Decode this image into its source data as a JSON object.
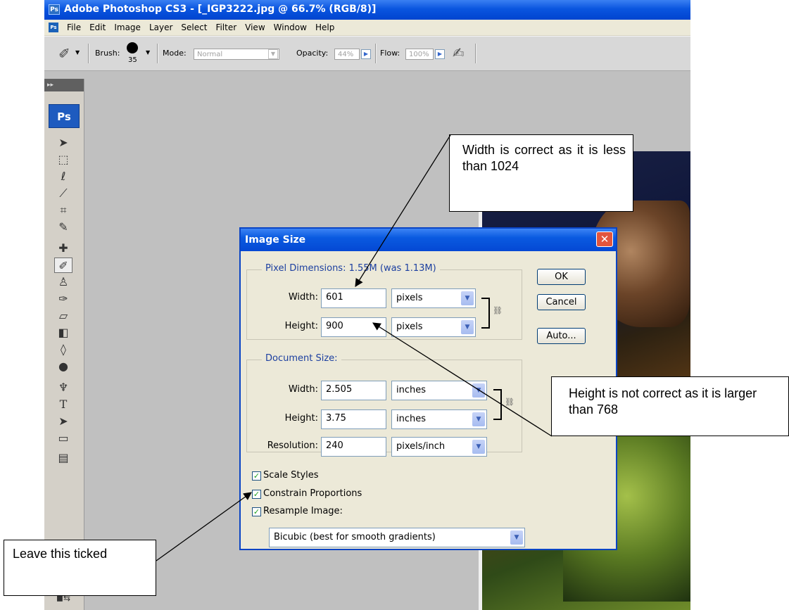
{
  "window": {
    "logo": "Ps",
    "title": "Adobe Photoshop CS3 - [_IGP3222.jpg @ 66.7% (RGB/8)]"
  },
  "menubar": {
    "items": [
      "File",
      "Edit",
      "Image",
      "Layer",
      "Select",
      "Filter",
      "View",
      "Window",
      "Help"
    ]
  },
  "options_bar": {
    "brush_label": "Brush:",
    "brush_size": "35",
    "mode_label": "Mode:",
    "mode_value": "Normal",
    "opacity_label": "Opacity:",
    "opacity_value": "44%",
    "flow_label": "Flow:",
    "flow_value": "100%"
  },
  "toolbox": {
    "badge": "Ps",
    "tools": [
      "move-tool-icon",
      "marquee-tool-icon",
      "lasso-tool-icon",
      "magic-wand-icon",
      "crop-tool-icon",
      "slice-tool-icon",
      "healing-brush-icon",
      "brush-tool-icon",
      "clone-stamp-icon",
      "history-brush-icon",
      "eraser-icon",
      "gradient-tool-icon",
      "blur-tool-icon",
      "dodge-tool-icon",
      "pen-tool-icon",
      "type-tool-icon",
      "path-selection-icon",
      "shape-tool-icon",
      "notes-tool-icon"
    ]
  },
  "dialog": {
    "title": "Image Size",
    "pixel_dimensions": {
      "legend": "Pixel Dimensions:  1.55M (was 1.13M)",
      "width_label": "Width:",
      "width_value": "601",
      "width_unit": "pixels",
      "height_label": "Height:",
      "height_value": "900",
      "height_unit": "pixels"
    },
    "document_size": {
      "legend": "Document Size:",
      "width_label": "Width:",
      "width_value": "2.505",
      "width_unit": "inches",
      "height_label": "Height:",
      "height_value": "3.75",
      "height_unit": "inches",
      "resolution_label": "Resolution:",
      "resolution_value": "240",
      "resolution_unit": "pixels/inch"
    },
    "buttons": {
      "ok": "OK",
      "cancel": "Cancel",
      "auto": "Auto..."
    },
    "checkboxes": {
      "scale_styles": "Scale Styles",
      "constrain_proportions": "Constrain Proportions",
      "resample_image": "Resample Image:"
    },
    "resample_method": "Bicubic (best for smooth gradients)"
  },
  "callouts": {
    "width": "Width is correct as it is less than 1024",
    "height": "Height is not correct as it is larger than 768",
    "constrain": "Leave this ticked"
  }
}
